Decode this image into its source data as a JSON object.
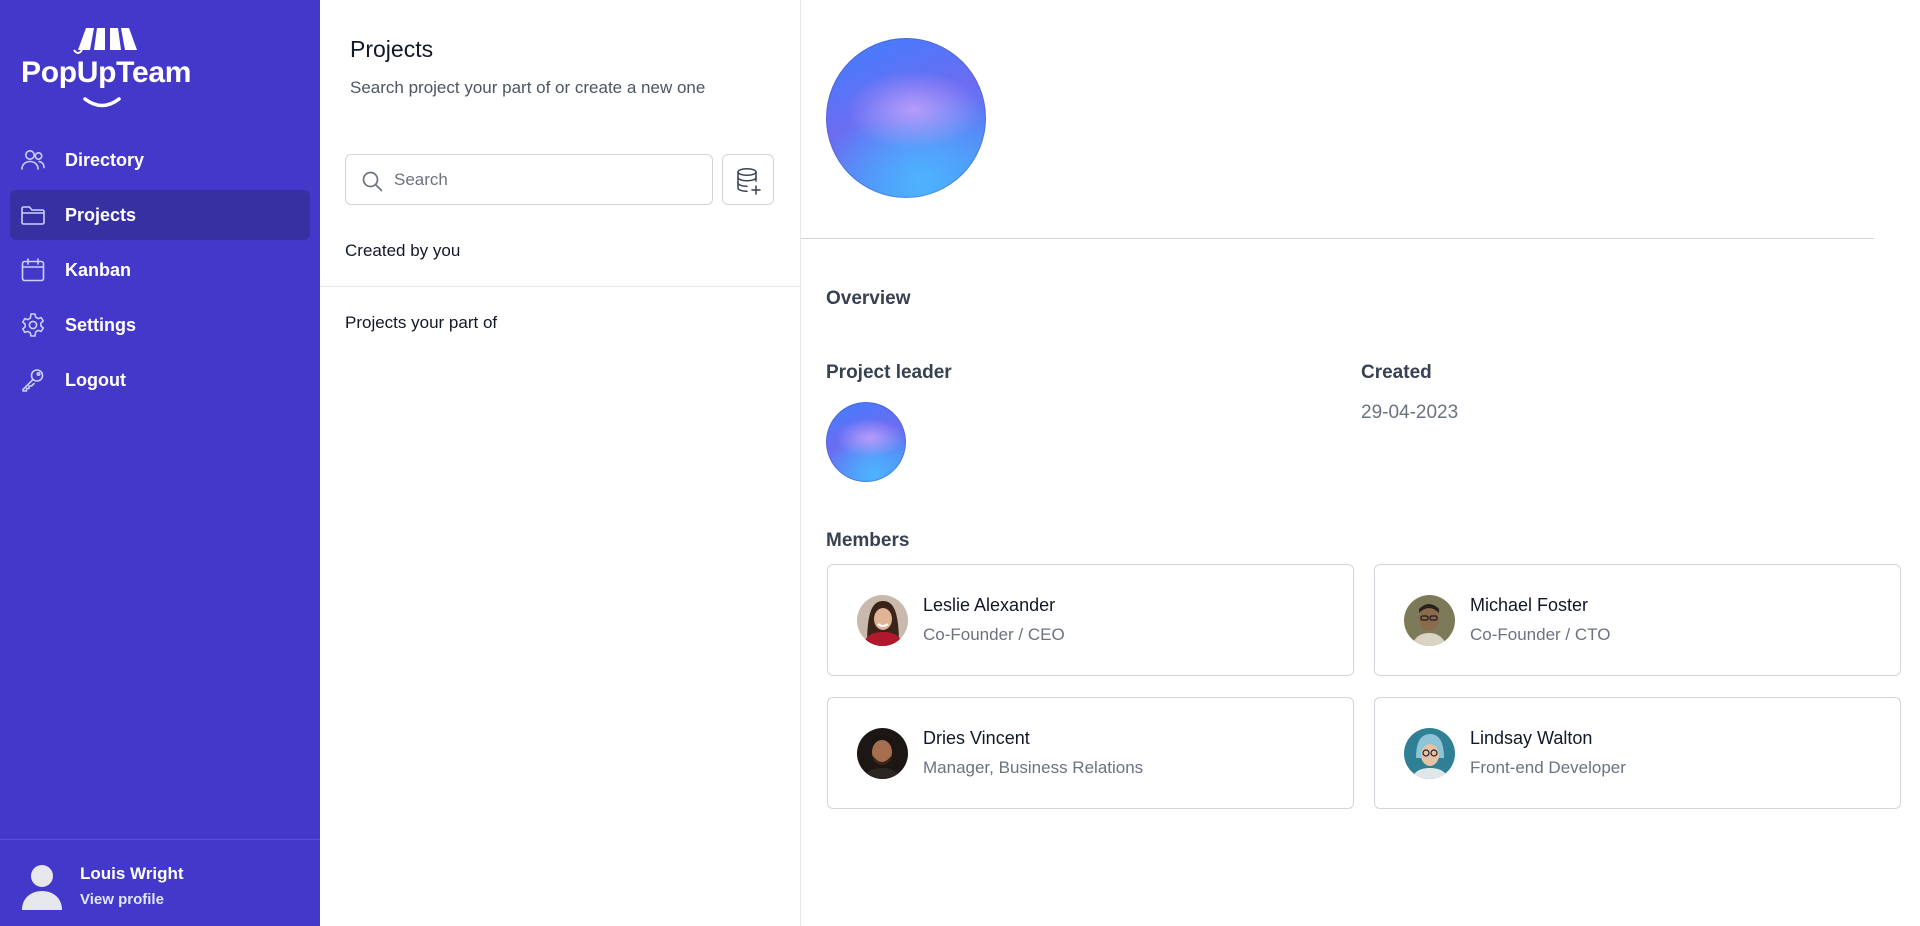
{
  "brand": {
    "name": "PopUpTeam"
  },
  "sidebar": {
    "items": [
      {
        "label": "Directory",
        "icon": "users-icon",
        "active": false
      },
      {
        "label": "Projects",
        "icon": "folder-icon",
        "active": true
      },
      {
        "label": "Kanban",
        "icon": "calendar-icon",
        "active": false
      },
      {
        "label": "Settings",
        "icon": "gear-icon",
        "active": false
      },
      {
        "label": "Logout",
        "icon": "key-icon",
        "active": false
      }
    ],
    "profile": {
      "name": "Louis Wright",
      "link": "View profile"
    }
  },
  "projects_panel": {
    "title": "Projects",
    "subtitle": "Search project your part of or create a new one",
    "search": {
      "placeholder": "Search",
      "value": ""
    },
    "sections": [
      "Created by you",
      "Projects your part of"
    ]
  },
  "detail": {
    "overview_heading": "Overview",
    "leader_heading": "Project leader",
    "created_heading": "Created",
    "created_value": "29-04-2023",
    "members_heading": "Members",
    "members": [
      {
        "name": "Leslie Alexander",
        "role": "Co-Founder / CEO"
      },
      {
        "name": "Michael Foster",
        "role": "Co-Founder / CTO"
      },
      {
        "name": "Dries Vincent",
        "role": "Manager, Business Relations"
      },
      {
        "name": "Lindsay Walton",
        "role": "Front-end Developer"
      }
    ]
  },
  "colors": {
    "sidebar": "#4438ca",
    "sidebar_active": "#3730a3",
    "text_muted": "#6b7280",
    "border": "#d1d5db"
  }
}
